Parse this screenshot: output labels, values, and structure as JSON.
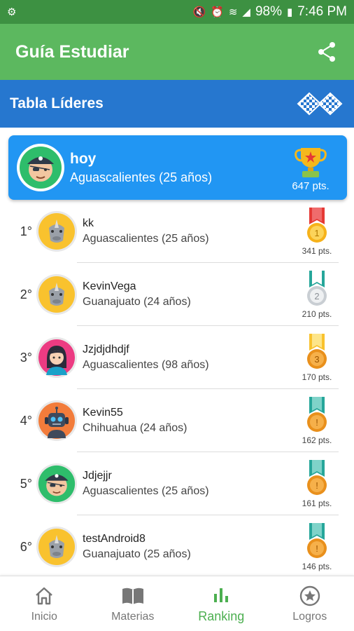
{
  "status": {
    "battery": "98%",
    "time": "7:46 PM"
  },
  "app": {
    "title": "Guía Estudiar"
  },
  "section": {
    "title": "Tabla Líderes"
  },
  "me": {
    "name": "hoy",
    "location": "Aguascalientes (25 años)",
    "points": "647 pts."
  },
  "leaders": [
    {
      "rank": "1°",
      "name": "kk",
      "location": "Aguascalientes (25 años)",
      "points": "341 pts.",
      "avatar": "rhino",
      "medal_number": "1"
    },
    {
      "rank": "2°",
      "name": "KevinVega",
      "location": "Guanajuato (24 años)",
      "points": "210 pts.",
      "avatar": "rhino",
      "medal_number": "2"
    },
    {
      "rank": "3°",
      "name": "Jzjdjdhdjf",
      "location": "Aguascalientes (98 años)",
      "points": "170 pts.",
      "avatar": "girl",
      "medal_number": "3"
    },
    {
      "rank": "4°",
      "name": "Kevin55",
      "location": "Chihuahua (24 años)",
      "points": "162 pts.",
      "avatar": "robot",
      "medal_number": "!"
    },
    {
      "rank": "5°",
      "name": "Jdjejjr",
      "location": "Aguascalientes (25 años)",
      "points": "161 pts.",
      "avatar": "pirate",
      "medal_number": "!"
    },
    {
      "rank": "6°",
      "name": "testAndroid8",
      "location": "Guanajuato (25 años)",
      "points": "146 pts.",
      "avatar": "rhino",
      "medal_number": "!"
    }
  ],
  "nav": [
    {
      "label": "Inicio",
      "icon": "home-icon"
    },
    {
      "label": "Materias",
      "icon": "book-icon"
    },
    {
      "label": "Ranking",
      "icon": "bar-chart-icon"
    },
    {
      "label": "Logros",
      "icon": "star-badge-icon"
    }
  ],
  "colors": {
    "app_bar": "#5cb85f",
    "status_bar": "#3d9142",
    "section_bar": "#2677cf",
    "me_card": "#2196f3",
    "active_nav": "#4caf50"
  }
}
